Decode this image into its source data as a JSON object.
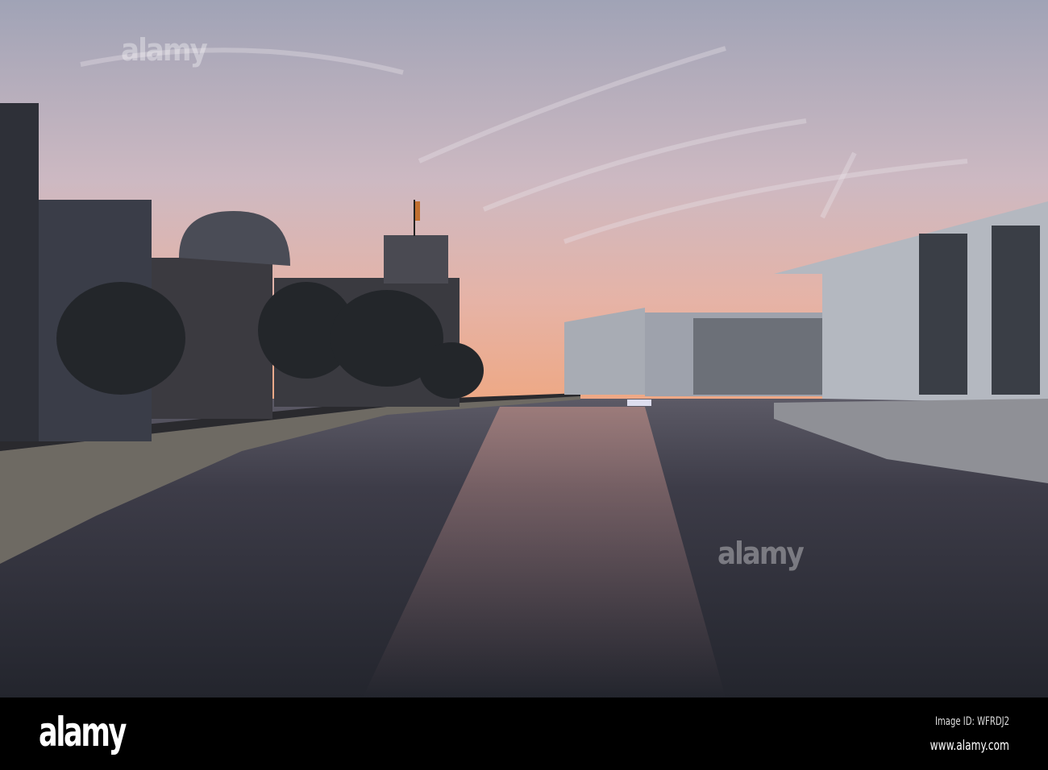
{
  "watermark": {
    "logo": "alamy",
    "image_id": "Image ID: WFRDJ2",
    "site": "www.alamy.com"
  },
  "colors": {
    "sky_top": "#a4a6b8",
    "sky_mid": "#d6bcc0",
    "horizon": "#e9a98c",
    "water": "#2b2f3a"
  }
}
